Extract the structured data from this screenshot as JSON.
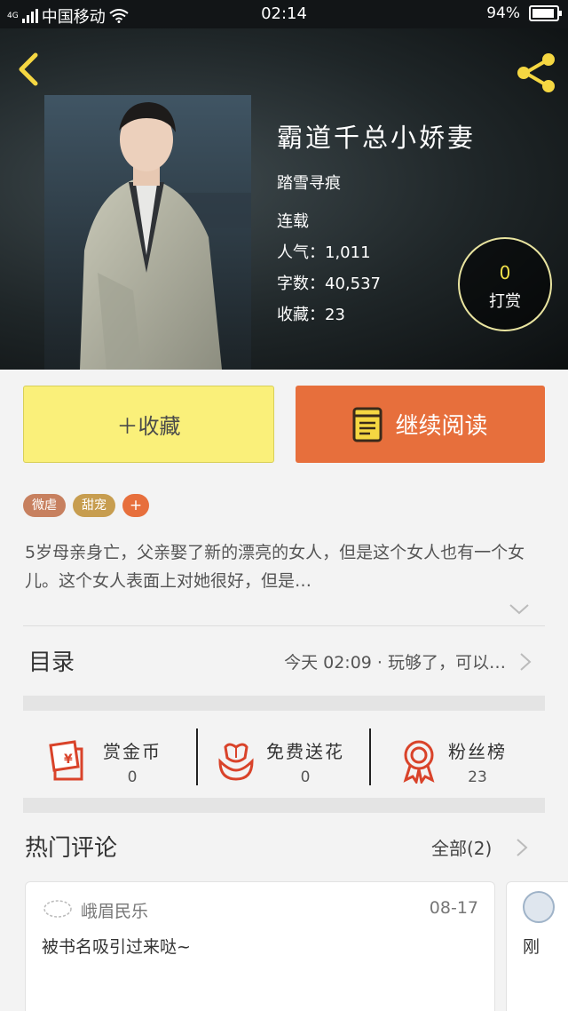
{
  "status_bar": {
    "signal": "4G",
    "carrier": "中国移动",
    "time": "02:14",
    "battery": "94%",
    "battery_level": 0.94
  },
  "book": {
    "title": "霸道千总小娇妻",
    "author": "踏雪寻痕",
    "status": "连载",
    "popularity": "人气：1,011",
    "word_count": "字数：40,537",
    "favorites": "收藏：23",
    "reward_count": "0",
    "reward_label": "打赏"
  },
  "buttons": {
    "collect_label": "＋收藏",
    "read_label": "继续阅读"
  },
  "tags": [
    {
      "label": "微虐"
    },
    {
      "label": "甜宠"
    }
  ],
  "tag_add_label": "+",
  "description": "5岁母亲身亡，父亲娶了新的漂亮的女人，但是这个女人也有一个女儿。这个女人表面上对她很好，但是…",
  "toc": {
    "label": "目录",
    "latest": "今天 02:09 · 玩够了，可以…"
  },
  "actions": [
    {
      "name": "赏金币",
      "count": "0",
      "icon": "red-envelope-icon"
    },
    {
      "name": "免费送花",
      "count": "0",
      "icon": "flower-icon"
    },
    {
      "name": "粉丝榜",
      "count": "23",
      "icon": "medal-icon"
    }
  ],
  "comments_section": {
    "title": "热门评论",
    "all_label": "全部(2)",
    "comments": [
      {
        "user": "峨眉民乐",
        "date": "08-17",
        "text": "被书名吸引过来哒~"
      },
      {
        "user": "",
        "date": "",
        "text": "刚"
      }
    ]
  },
  "colors": {
    "accent_orange": "#e76f3c",
    "collect_yellow": "#faf07a",
    "reward_yellow": "#f1e14a",
    "icon_red": "#d9432a"
  }
}
